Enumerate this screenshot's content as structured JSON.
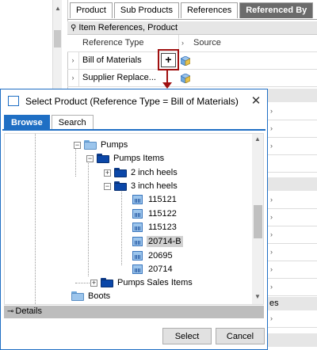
{
  "tabs": [
    {
      "label": "Product"
    },
    {
      "label": "Sub Products"
    },
    {
      "label": "References"
    },
    {
      "label": "Referenced By"
    }
  ],
  "section": {
    "title": "Item References, Product"
  },
  "grid": {
    "header": {
      "col1": "Reference Type",
      "col2": "Source"
    },
    "rows": [
      {
        "label": "Bill of Materials"
      },
      {
        "label": "Supplier Replace..."
      }
    ],
    "add_button_label": "+"
  },
  "background_right": {
    "partial_label": "es"
  },
  "dialog": {
    "title": "Select Product (Reference Type = Bill of Materials)",
    "close_glyph": "✕",
    "tabs": [
      {
        "label": "Browse"
      },
      {
        "label": "Search"
      }
    ],
    "tree": {
      "rows": [
        {
          "label": "Pumps"
        },
        {
          "label": "Pumps Items"
        },
        {
          "label": "2 inch heels"
        },
        {
          "label": "3 inch heels"
        },
        {
          "label": "115121"
        },
        {
          "label": "115122"
        },
        {
          "label": "115123"
        },
        {
          "label": "20714-B"
        },
        {
          "label": "20695"
        },
        {
          "label": "20714"
        },
        {
          "label": "Pumps Sales Items"
        },
        {
          "label": "Boots"
        }
      ],
      "selected_label": "20714-B"
    },
    "details_label": "Details",
    "buttons": {
      "select": "Select",
      "cancel": "Cancel"
    }
  },
  "colors": {
    "accent": "#1f6fc4",
    "active_tab": "#6b6b6b",
    "callout": "#a01010",
    "folder_dark": "#0b47a8",
    "folder_light": "#9cc5ec"
  }
}
